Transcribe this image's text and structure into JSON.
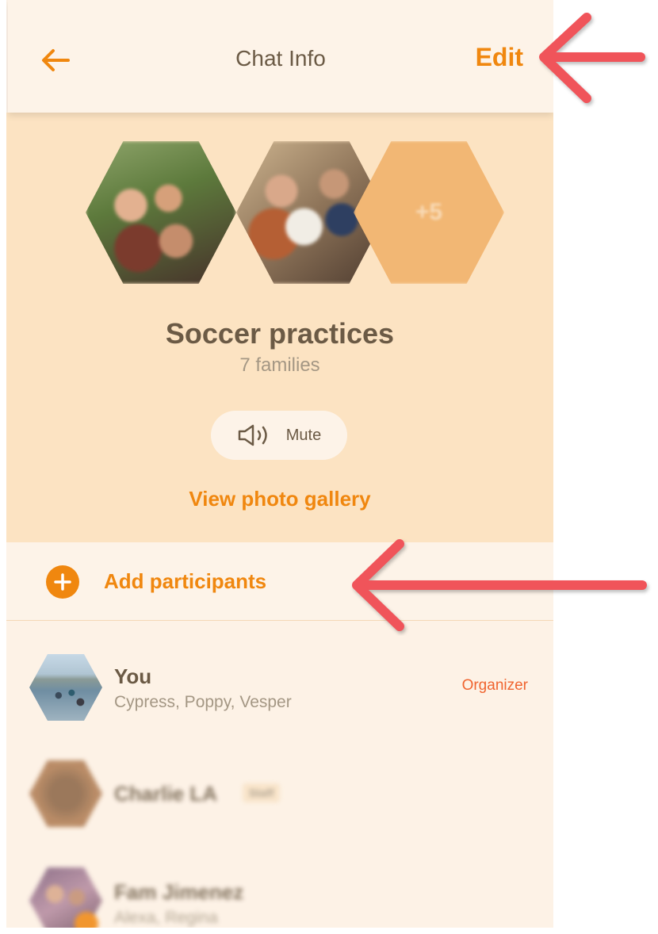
{
  "header": {
    "title": "Chat Info",
    "edit_label": "Edit"
  },
  "group": {
    "extra_count": "+5",
    "name": "Soccer practices",
    "subtitle": "7 families",
    "mute_label": "Mute",
    "gallery_link": "View photo gallery"
  },
  "add_participants": {
    "label": "Add participants"
  },
  "participants": [
    {
      "name": "You",
      "kids": "Cypress, Poppy, Vesper",
      "role": "Organizer"
    },
    {
      "name": "Charlie LA",
      "tag": "Staff"
    },
    {
      "name": "Fam Jimenez",
      "kids": "Alexa, Regina"
    }
  ],
  "colors": {
    "accent": "#f0870f",
    "organizer": "#f0642f",
    "hero_bg": "#fce3c2",
    "page_bg": "#fdf3e8",
    "annotation_arrow": "#f0545a"
  }
}
